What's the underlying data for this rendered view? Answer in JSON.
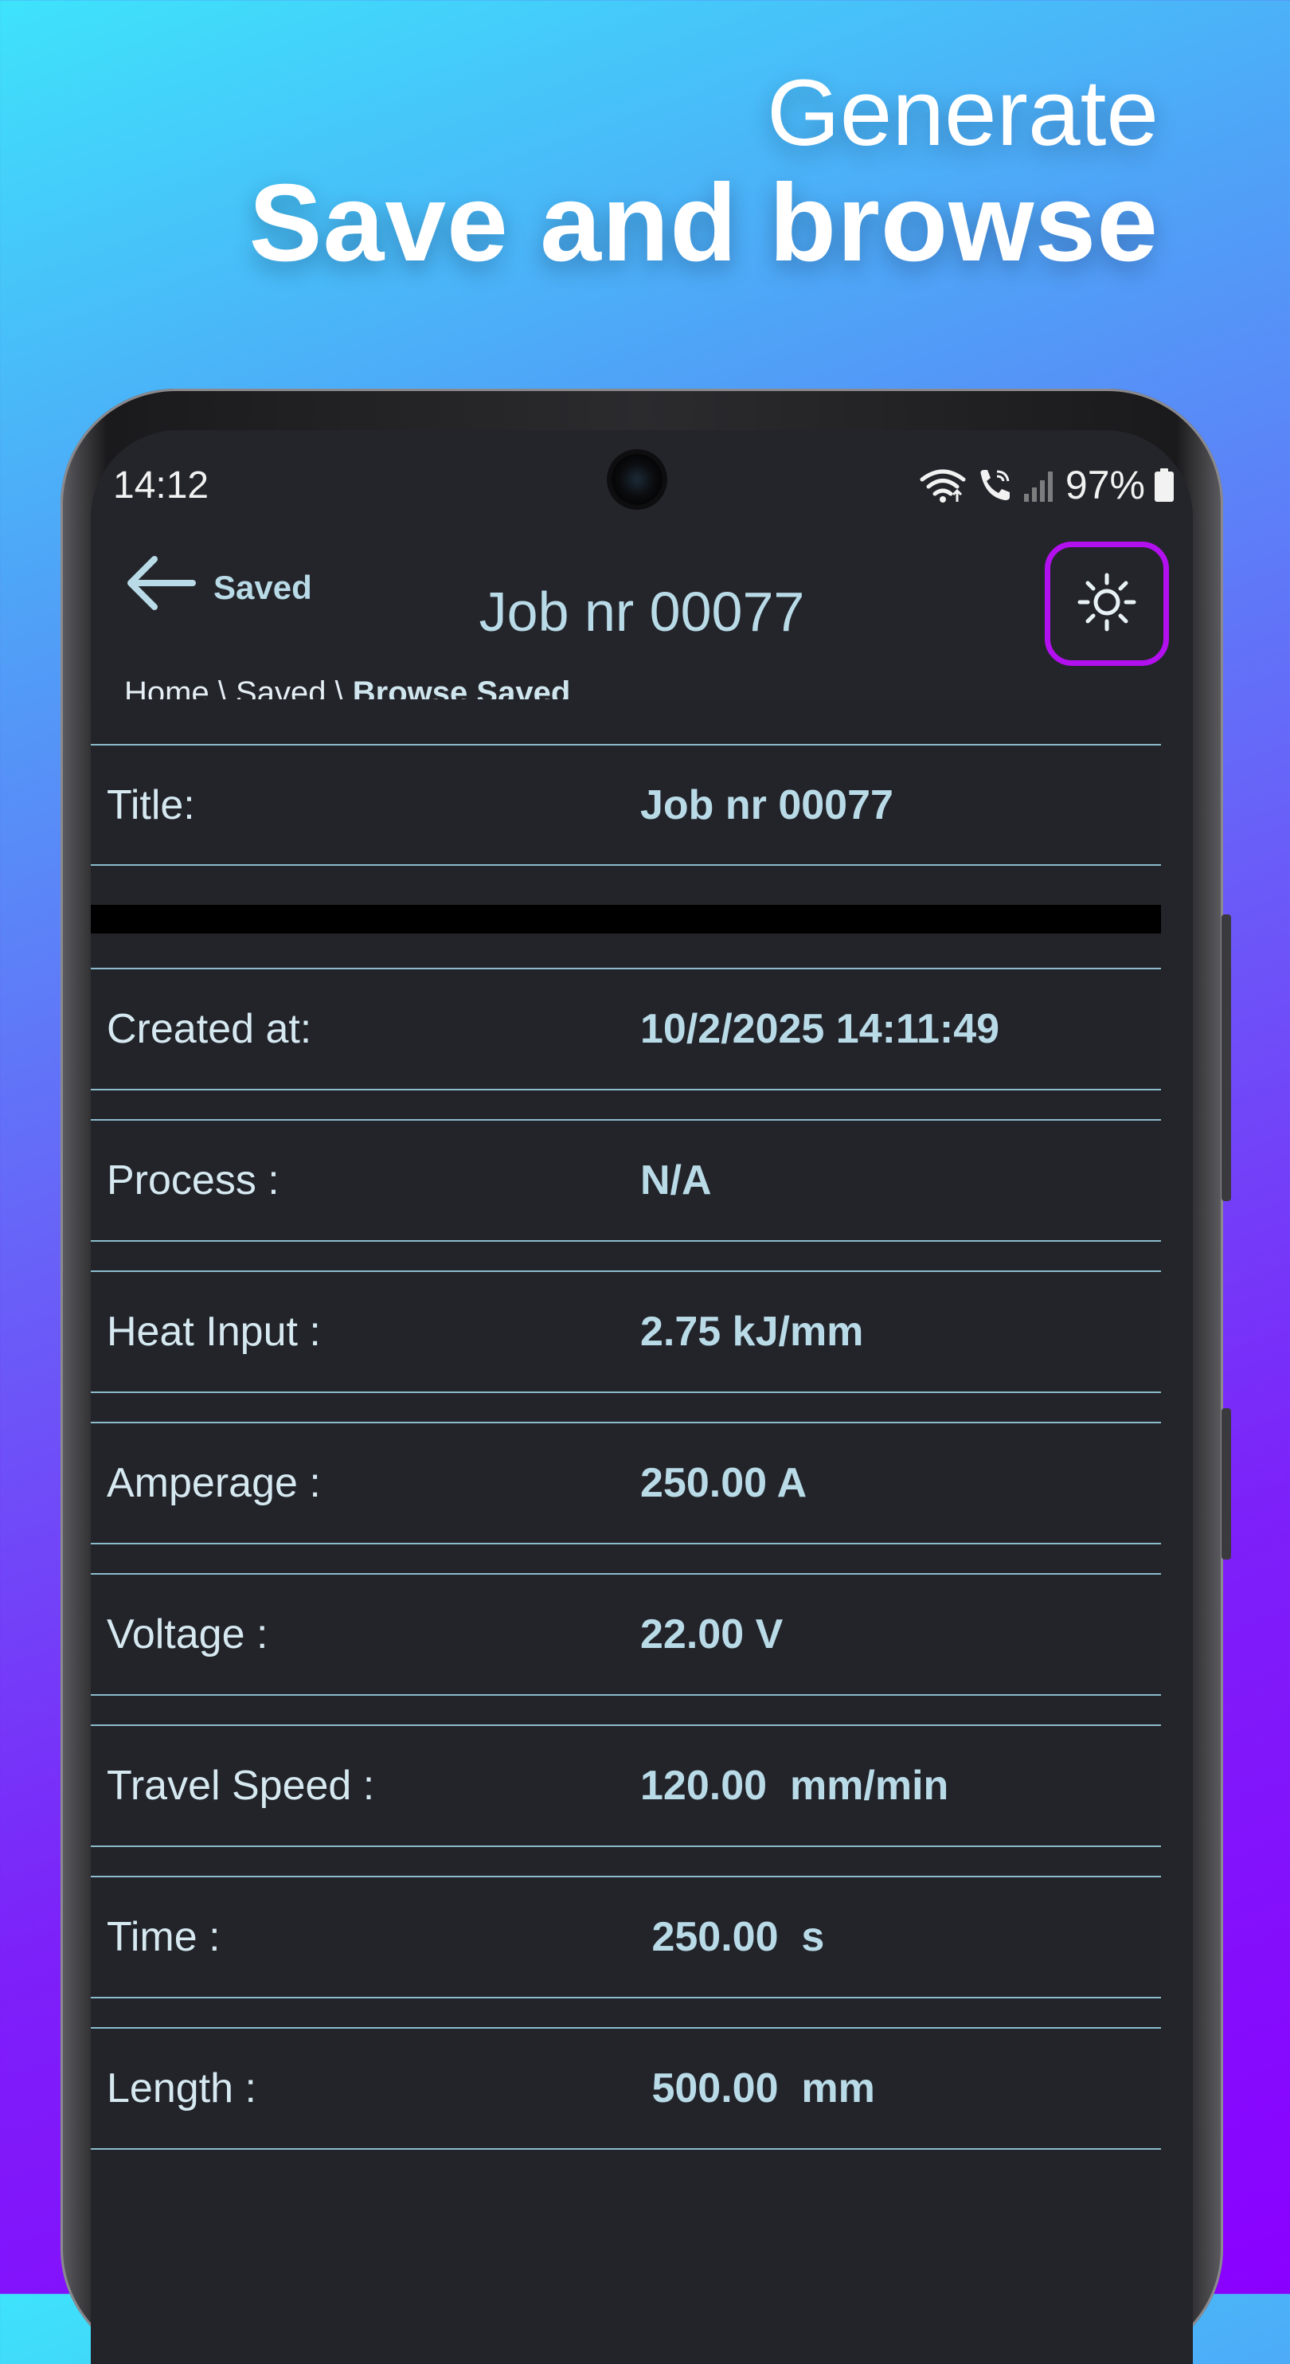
{
  "promo": {
    "line1": "Generate",
    "line2": "Save and browse"
  },
  "status_bar": {
    "time": "14:12",
    "battery": "97%"
  },
  "header": {
    "back_label": "Saved",
    "title": "Job nr 00077",
    "breadcrumb": {
      "path": "Home \\ Saved \\ ",
      "current": "Browse Saved"
    }
  },
  "details": [
    {
      "label": "Title:",
      "value": "Job nr 00077"
    },
    {
      "label": "Created at:",
      "value": "10/2/2025 14:11:49"
    },
    {
      "label": "Process :",
      "value": "N/A"
    },
    {
      "label": "Heat Input :",
      "value": "2.75 kJ/mm"
    },
    {
      "label": "Amperage :",
      "value": "250.00 A"
    },
    {
      "label": "Voltage :",
      "value": "22.00 V"
    },
    {
      "label": "Travel Speed :",
      "value": "120.00  mm/min"
    },
    {
      "label": "Time :",
      "value": " 250.00  s"
    },
    {
      "label": "Length :",
      "value": " 500.00  mm"
    }
  ],
  "icons": {
    "back": "arrow-left-icon",
    "theme": "sun-icon",
    "wifi": "wifi-icon",
    "call": "wifi-call-icon",
    "signal": "signal-icon",
    "battery": "battery-icon"
  },
  "colors": {
    "accent": "#b210ee",
    "text": "#b9dbe8",
    "divider": "#8bbccd",
    "background": "#24252a"
  }
}
